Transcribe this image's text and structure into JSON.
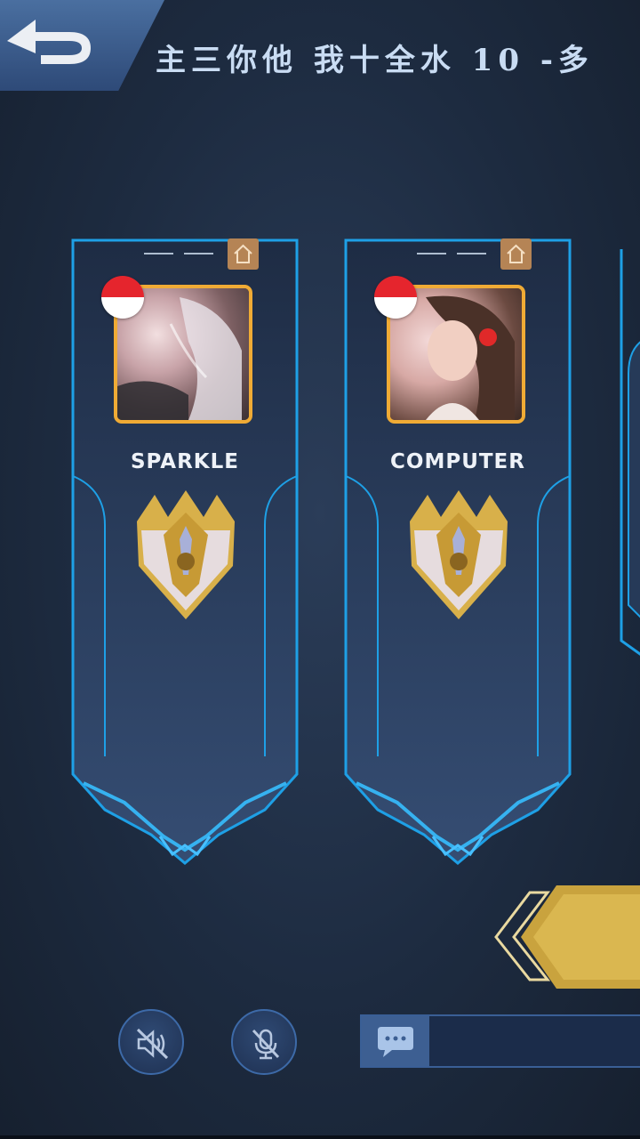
{
  "header": {
    "title": "主三你他 我十全水 10 -多",
    "back_icon": "back-arrow-icon"
  },
  "players": [
    {
      "name": "SPARKLE",
      "flag": "indonesia-flag",
      "avatar": "player-avatar",
      "rank_icon": "rank-badge-icon",
      "colors": {
        "avatar_border": "#f0ab35",
        "flag_top": "#e5252d"
      }
    },
    {
      "name": "COMPUTER",
      "flag": "indonesia-flag",
      "avatar": "player-avatar",
      "rank_icon": "rank-badge-icon",
      "colors": {
        "avatar_border": "#f0ab35",
        "flag_top": "#e5252d"
      }
    }
  ],
  "controls": {
    "speaker_icon": "speaker-muted-icon",
    "mic_icon": "mic-muted-icon",
    "chat_icon": "chat-bubble-icon",
    "home_icon": "home-icon",
    "chat_placeholder": ""
  },
  "colors": {
    "accent_blue": "#1ea0e6",
    "gold": "#d8b04a",
    "text_light": "#c9dcf3"
  }
}
